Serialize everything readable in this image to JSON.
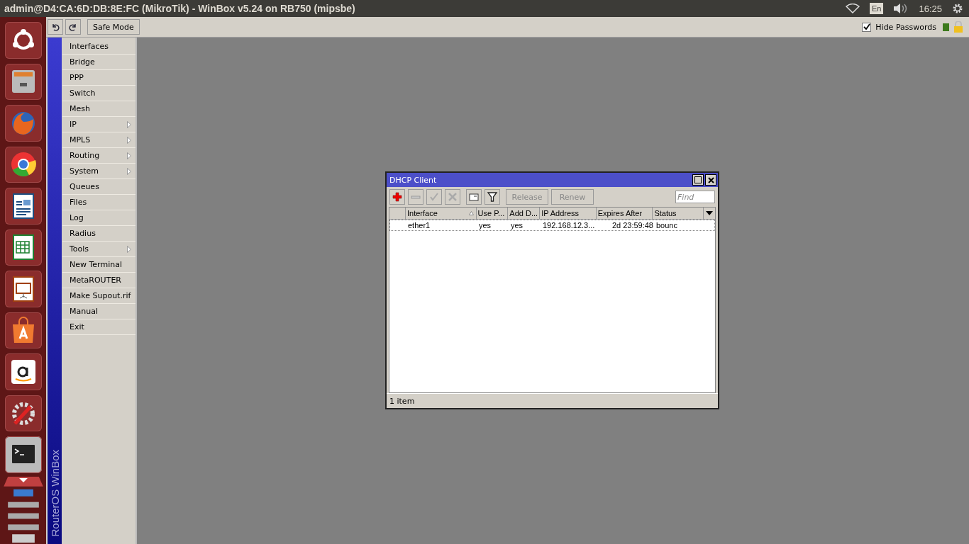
{
  "window": {
    "title": "admin@D4:CA:6D:DB:8E:FC (MikroTik) - WinBox v5.24 on RB750 (mipsbe)"
  },
  "top_panel": {
    "keyboard_layout": "En",
    "clock": "16:25"
  },
  "toolbar": {
    "safe_mode": "Safe Mode",
    "hide_passwords": {
      "label": "Hide Passwords",
      "checked": true
    }
  },
  "sidebar": {
    "brand": "RouterOS WinBox",
    "items": [
      {
        "label": "Interfaces",
        "submenu": false
      },
      {
        "label": "Bridge",
        "submenu": false
      },
      {
        "label": "PPP",
        "submenu": false
      },
      {
        "label": "Switch",
        "submenu": false
      },
      {
        "label": "Mesh",
        "submenu": false
      },
      {
        "label": "IP",
        "submenu": true
      },
      {
        "label": "MPLS",
        "submenu": true
      },
      {
        "label": "Routing",
        "submenu": true
      },
      {
        "label": "System",
        "submenu": true
      },
      {
        "label": "Queues",
        "submenu": false
      },
      {
        "label": "Files",
        "submenu": false
      },
      {
        "label": "Log",
        "submenu": false
      },
      {
        "label": "Radius",
        "submenu": false
      },
      {
        "label": "Tools",
        "submenu": true
      },
      {
        "label": "New Terminal",
        "submenu": false
      },
      {
        "label": "MetaROUTER",
        "submenu": false
      },
      {
        "label": "Make Supout.rif",
        "submenu": false
      },
      {
        "label": "Manual",
        "submenu": false
      },
      {
        "label": "Exit",
        "submenu": false
      }
    ]
  },
  "dhcp_client": {
    "title": "DHCP Client",
    "tools": [
      {
        "kind": "add",
        "disabled": false
      },
      {
        "kind": "remove",
        "disabled": true
      },
      {
        "kind": "enable",
        "disabled": true
      },
      {
        "kind": "disable",
        "disabled": true
      },
      {
        "kind": "comment",
        "disabled": false
      },
      {
        "kind": "filter",
        "disabled": false
      }
    ],
    "buttons": [
      {
        "label": "Release",
        "disabled": true
      },
      {
        "label": "Renew",
        "disabled": true
      }
    ],
    "find": {
      "placeholder": "Find"
    },
    "table": {
      "columns": [
        {
          "label": "Interface",
          "sorted": true
        },
        {
          "label": "Use P...",
          "sorted": false
        },
        {
          "label": "Add D...",
          "sorted": false
        },
        {
          "label": "IP Address",
          "sorted": false
        },
        {
          "label": "Expires After",
          "sorted": false
        },
        {
          "label": "Status",
          "sorted": false
        }
      ],
      "rows": [
        {
          "cells": [
            "ether1",
            "yes",
            "yes",
            "192.168.12.3...",
            "2d 23:59:48",
            "bounc"
          ]
        }
      ]
    },
    "status": "1 item"
  }
}
